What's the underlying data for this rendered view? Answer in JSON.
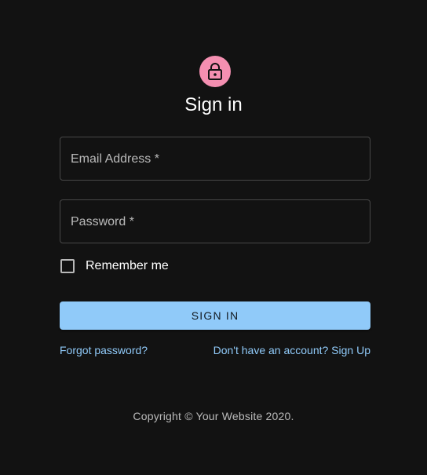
{
  "header": {
    "avatar_icon": "lock-outline-icon",
    "avatar_color": "#f48fb1",
    "title": "Sign in"
  },
  "form": {
    "email_label": "Email Address *",
    "email_value": "",
    "password_label": "Password *",
    "password_value": "",
    "remember_label": "Remember me",
    "remember_checked": false,
    "submit_label": "SIGN IN",
    "submit_color": "#90caf9"
  },
  "links": {
    "forgot_password": "Forgot password?",
    "sign_up": "Don't have an account? Sign Up",
    "link_color": "#90caf9"
  },
  "footer": {
    "copyright": "Copyright © Your Website 2020."
  },
  "theme": {
    "background": "#121212"
  }
}
